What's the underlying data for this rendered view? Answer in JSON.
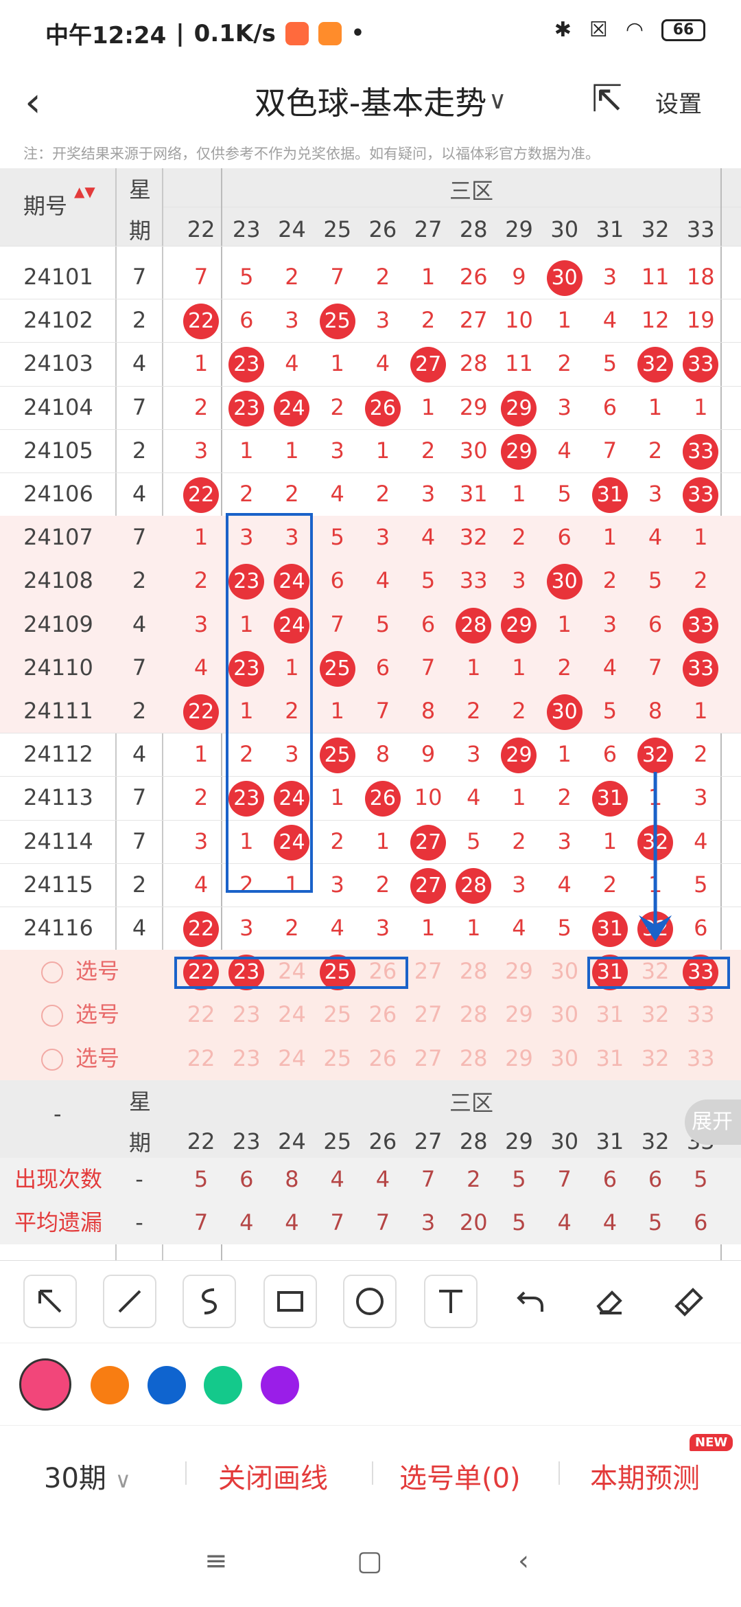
{
  "status": {
    "time": "中午12:24",
    "speed": "0.1K/s",
    "battery": "66",
    "dot": "•"
  },
  "header": {
    "title": "双色球-基本走势",
    "settings": "设置"
  },
  "note": "注：开奖结果来源于网络，仅供参考不作为兑奖依据。如有疑问，以福体彩官方数据为准。",
  "table": {
    "col_period": "期号",
    "col_week_top": "星",
    "col_week_bottom": "期",
    "zone": "三区",
    "numbers": [
      "22",
      "23",
      "24",
      "25",
      "26",
      "27",
      "28",
      "29",
      "30",
      "31",
      "32",
      "33"
    ],
    "rows": [
      {
        "period": "24101",
        "week": "7",
        "vals": [
          "7",
          "5",
          "2",
          "7",
          "2",
          "1",
          "26",
          "9",
          "30",
          "3",
          "11",
          "18"
        ],
        "hits": [
          8
        ]
      },
      {
        "period": "24102",
        "week": "2",
        "vals": [
          "22",
          "6",
          "3",
          "25",
          "3",
          "2",
          "27",
          "10",
          "1",
          "4",
          "12",
          "19"
        ],
        "hits": [
          0,
          3
        ]
      },
      {
        "period": "24103",
        "week": "4",
        "vals": [
          "1",
          "23",
          "4",
          "1",
          "4",
          "27",
          "28",
          "11",
          "2",
          "5",
          "32",
          "33"
        ],
        "hits": [
          1,
          5,
          10,
          11
        ]
      },
      {
        "period": "24104",
        "week": "7",
        "vals": [
          "2",
          "23",
          "24",
          "2",
          "26",
          "1",
          "29",
          "29",
          "3",
          "6",
          "1",
          "1"
        ],
        "hits": [
          1,
          2,
          4,
          7
        ]
      },
      {
        "period": "24105",
        "week": "2",
        "vals": [
          "3",
          "1",
          "1",
          "3",
          "1",
          "2",
          "30",
          "29",
          "4",
          "7",
          "2",
          "33"
        ],
        "hits": [
          7,
          11
        ]
      },
      {
        "period": "24106",
        "week": "4",
        "vals": [
          "22",
          "2",
          "2",
          "4",
          "2",
          "3",
          "31",
          "1",
          "5",
          "31",
          "3",
          "33"
        ],
        "hits": [
          0,
          9,
          11
        ]
      },
      {
        "period": "24107",
        "week": "7",
        "vals": [
          "1",
          "3",
          "3",
          "5",
          "3",
          "4",
          "32",
          "2",
          "6",
          "1",
          "4",
          "1"
        ],
        "hits": []
      },
      {
        "period": "24108",
        "week": "2",
        "vals": [
          "2",
          "23",
          "24",
          "6",
          "4",
          "5",
          "33",
          "3",
          "30",
          "2",
          "5",
          "2"
        ],
        "hits": [
          1,
          2,
          8
        ]
      },
      {
        "period": "24109",
        "week": "4",
        "vals": [
          "3",
          "1",
          "24",
          "7",
          "5",
          "6",
          "28",
          "29",
          "1",
          "3",
          "6",
          "33"
        ],
        "hits": [
          2,
          6,
          7,
          11
        ]
      },
      {
        "period": "24110",
        "week": "7",
        "vals": [
          "4",
          "23",
          "1",
          "25",
          "6",
          "7",
          "1",
          "1",
          "2",
          "4",
          "7",
          "33"
        ],
        "hits": [
          1,
          3,
          11
        ]
      },
      {
        "period": "24111",
        "week": "2",
        "vals": [
          "22",
          "1",
          "2",
          "1",
          "7",
          "8",
          "2",
          "2",
          "30",
          "5",
          "8",
          "1"
        ],
        "hits": [
          0,
          8
        ]
      },
      {
        "period": "24112",
        "week": "4",
        "vals": [
          "1",
          "2",
          "3",
          "25",
          "8",
          "9",
          "3",
          "29",
          "1",
          "6",
          "32",
          "2"
        ],
        "hits": [
          3,
          7,
          10
        ]
      },
      {
        "period": "24113",
        "week": "7",
        "vals": [
          "2",
          "23",
          "24",
          "1",
          "26",
          "10",
          "4",
          "1",
          "2",
          "31",
          "1",
          "3"
        ],
        "hits": [
          1,
          2,
          4,
          9
        ]
      },
      {
        "period": "24114",
        "week": "7",
        "vals": [
          "3",
          "1",
          "24",
          "2",
          "1",
          "27",
          "5",
          "2",
          "3",
          "1",
          "32",
          "4"
        ],
        "hits": [
          2,
          5,
          10
        ]
      },
      {
        "period": "24115",
        "week": "2",
        "vals": [
          "4",
          "2",
          "1",
          "3",
          "2",
          "27",
          "28",
          "3",
          "4",
          "2",
          "1",
          "5"
        ],
        "hits": [
          5,
          6
        ]
      },
      {
        "period": "24116",
        "week": "4",
        "vals": [
          "22",
          "3",
          "2",
          "4",
          "3",
          "1",
          "1",
          "4",
          "5",
          "31",
          "32",
          "6"
        ],
        "hits": [
          0,
          9,
          10
        ]
      }
    ],
    "select_label": "选号",
    "select_hits": [
      0,
      1,
      3,
      9,
      11
    ],
    "stats": {
      "dash": "-",
      "appear_label": "出现次数",
      "appear": [
        "5",
        "6",
        "8",
        "4",
        "4",
        "7",
        "2",
        "5",
        "7",
        "6",
        "6",
        "5"
      ],
      "avg_label": "平均遗漏",
      "avg": [
        "7",
        "4",
        "4",
        "7",
        "7",
        "3",
        "20",
        "5",
        "4",
        "4",
        "5",
        "6"
      ]
    },
    "expand": "展开"
  },
  "colors": {
    "pink": "#f2467a",
    "orange": "#f87d12",
    "blue": "#0f64cf",
    "green": "#14c98b",
    "purple": "#9a1ee8",
    "box": "#1a62c9",
    "ball": "#e8333a"
  },
  "bottom": {
    "periods": "30期",
    "close_line": "关闭画线",
    "selection": "选号单(0)",
    "predict": "本期预测",
    "new_badge": "NEW"
  }
}
